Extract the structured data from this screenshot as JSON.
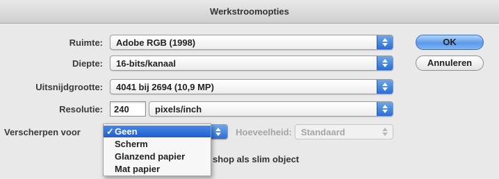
{
  "window": {
    "title": "Werkstroomopties"
  },
  "form": {
    "space": {
      "label": "Ruimte:",
      "value": "Adobe RGB (1998)"
    },
    "depth": {
      "label": "Diepte:",
      "value": "16-bits/kanaal"
    },
    "crop_size": {
      "label": "Uitsnijdgrootte:",
      "value": "4041 bij 2694  (10,9 MP)"
    },
    "resolution": {
      "label": "Resolutie:",
      "value": "240",
      "unit": "pixels/inch"
    },
    "sharpen": {
      "label": "Verscherpen voor",
      "value": "Geen"
    },
    "amount": {
      "label": "Hoeveelheid:",
      "value": "Standaard"
    },
    "open_as_smart_object_text": "shop als slim object"
  },
  "buttons": {
    "ok": "OK",
    "cancel": "Annuleren"
  },
  "sharpen_menu": {
    "check": "✓",
    "items": [
      {
        "label": "Geen",
        "selected": true
      },
      {
        "label": "Scherm"
      },
      {
        "label": "Glanzend papier"
      },
      {
        "label": "Mat papier"
      }
    ]
  },
  "colors": {
    "accent": "#2b6ed2",
    "selection": "#1f5fcf",
    "background": "#e9e9e9"
  }
}
